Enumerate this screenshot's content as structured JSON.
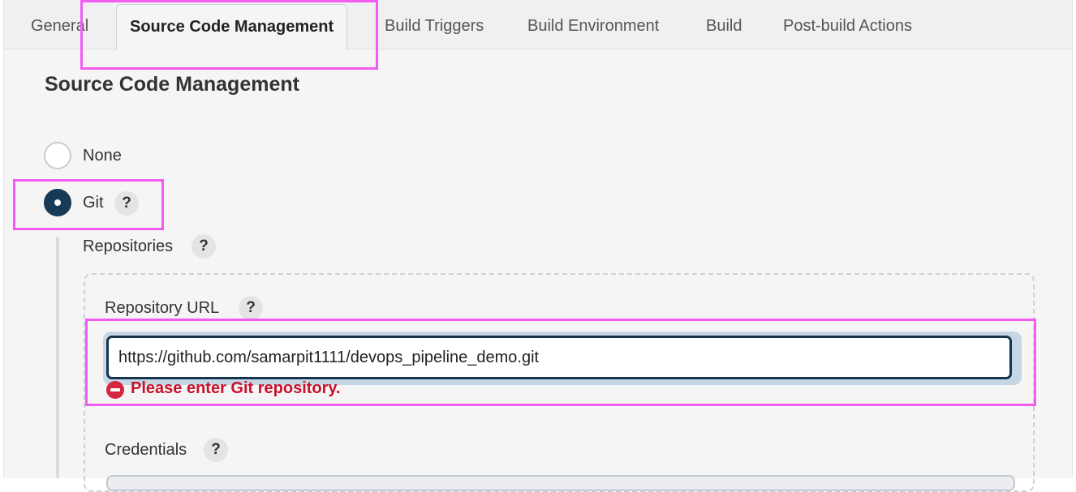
{
  "tabs": [
    {
      "label": "General"
    },
    {
      "label": "Source Code Management"
    },
    {
      "label": "Build Triggers"
    },
    {
      "label": "Build Environment"
    },
    {
      "label": "Build"
    },
    {
      "label": "Post-build Actions"
    }
  ],
  "section": {
    "title": "Source Code Management"
  },
  "scm": {
    "options": [
      {
        "label": "None",
        "checked": false
      },
      {
        "label": "Git",
        "checked": true
      }
    ],
    "repositories_label": "Repositories",
    "repo_url_label": "Repository URL",
    "repo_url_value": "https://github.com/samarpit1111/devops_pipeline_demo.git",
    "error": "Please enter Git repository.",
    "credentials_label": "Credentials",
    "help_glyph": "?"
  },
  "colors": {
    "highlight": "#f35cf0",
    "radio_checked": "#163a57",
    "error": "#c8112b"
  }
}
